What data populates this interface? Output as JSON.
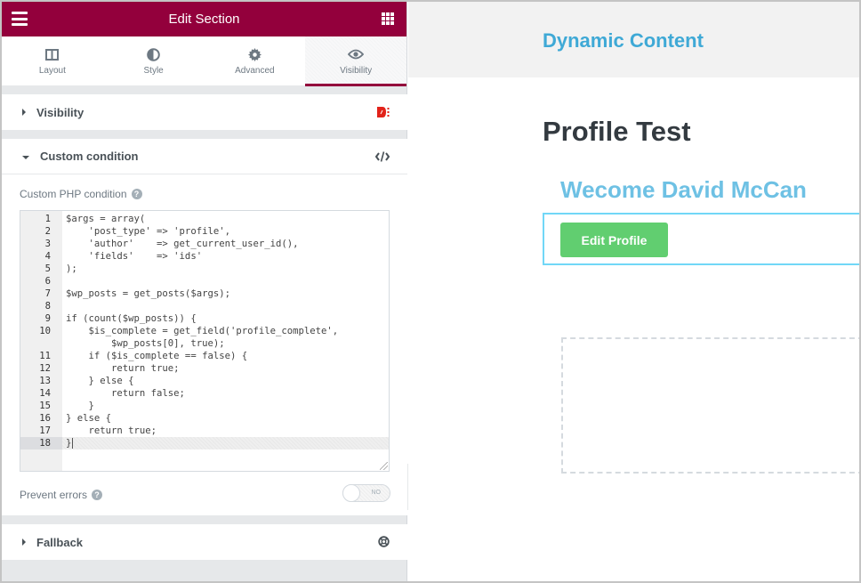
{
  "panel": {
    "header": {
      "title": "Edit Section",
      "menu_icon": "hamburger-icon",
      "apps_icon": "grid-icon"
    },
    "tabs": [
      {
        "label": "Layout",
        "icon": "columns-icon",
        "active": false
      },
      {
        "label": "Style",
        "icon": "half-circle-icon",
        "active": false
      },
      {
        "label": "Advanced",
        "icon": "gear-icon",
        "active": false
      },
      {
        "label": "Visibility",
        "icon": "eye-icon",
        "active": true
      }
    ],
    "sections": {
      "visibility": {
        "title": "Visibility",
        "expanded": false,
        "icon": "dynamic-visibility-icon",
        "icon_color": "#e2231a"
      },
      "custom_condition": {
        "title": "Custom condition",
        "expanded": true,
        "icon": "code-icon",
        "php_label": "Custom PHP condition",
        "help": "?",
        "code_lines": [
          {
            "n": "1",
            "text": "$args = array("
          },
          {
            "n": "2",
            "text": "    'post_type' => 'profile',"
          },
          {
            "n": "3",
            "text": "    'author'    => get_current_user_id(),"
          },
          {
            "n": "4",
            "text": "    'fields'    => 'ids'"
          },
          {
            "n": "5",
            "text": ");"
          },
          {
            "n": "6",
            "text": ""
          },
          {
            "n": "7",
            "text": "$wp_posts = get_posts($args);"
          },
          {
            "n": "8",
            "text": ""
          },
          {
            "n": "9",
            "text": "if (count($wp_posts)) {"
          },
          {
            "n": "10",
            "text": "    $is_complete = get_field('profile_complete',"
          },
          {
            "n": "",
            "text": "        $wp_posts[0], true);"
          },
          {
            "n": "11",
            "text": "    if ($is_complete == false) {"
          },
          {
            "n": "12",
            "text": "        return true;"
          },
          {
            "n": "13",
            "text": "    } else {"
          },
          {
            "n": "14",
            "text": "        return false;"
          },
          {
            "n": "15",
            "text": "    }"
          },
          {
            "n": "16",
            "text": "} else {"
          },
          {
            "n": "17",
            "text": "    return true;"
          },
          {
            "n": "18",
            "text": "}"
          }
        ],
        "active_line": "18",
        "prevent_errors_label": "Prevent errors",
        "prevent_errors_toggle": "NO"
      },
      "fallback": {
        "title": "Fallback",
        "expanded": false,
        "icon": "lifebuoy-icon"
      }
    },
    "collapse_icon": "‹",
    "accent_color": "#93003c"
  },
  "preview": {
    "site_title": "Dynamic Content",
    "page_title": "Profile Test",
    "welcome_heading": "Wecome David McCan",
    "edit_button": "Edit Profile",
    "colors": {
      "site_title": "#3fa9d6",
      "welcome": "#6ec1e4",
      "button": "#61ce70"
    }
  }
}
